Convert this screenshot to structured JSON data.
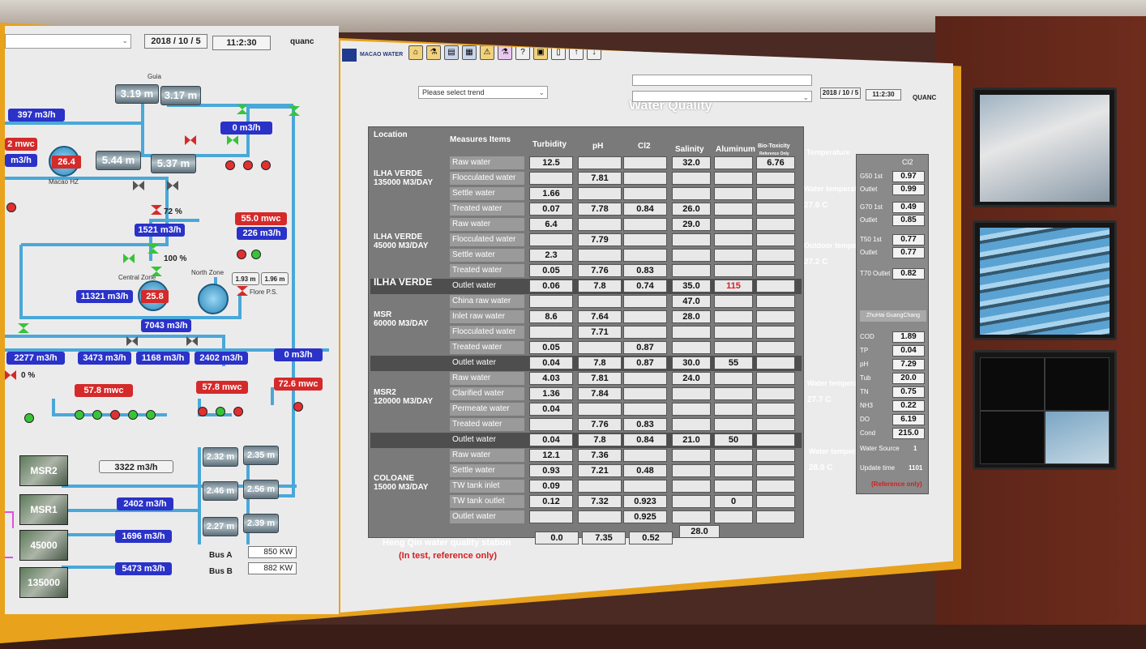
{
  "left_panel": {
    "date": "2018 / 10 / 5",
    "time": "11:2:30",
    "user": "quanc",
    "labels": {
      "guia": "Guia",
      "macao_hz": "Macao HZ",
      "central_zone": "Central Zone",
      "north_zone": "North Zone",
      "flore_ps": "Flore P.S."
    },
    "tanks": [
      "3.19 m",
      "3.17 m",
      "5.44 m",
      "5.37 m",
      "2.32 m",
      "2.35 m",
      "2.46 m",
      "2.56 m",
      "2.27 m",
      "2.39 m"
    ],
    "small_tanks": [
      "1.93 m",
      "1.96 m"
    ],
    "flows_blue": [
      "397 m3/h",
      "0 m3/h",
      "1521 m3/h",
      "226 m3/h",
      "11321 m3/h",
      "7043 m3/h",
      "2277 m3/h",
      "3473 m3/h",
      "1168 m3/h",
      "2402 m3/h",
      "0 m3/h",
      "2402 m3/h",
      "1696 m3/h",
      "5473 m3/h"
    ],
    "flows_red": [
      "2 mwc",
      "55.0 mwc",
      "57.8 mwc",
      "57.8 mwc",
      "72.6 mwc"
    ],
    "flows_left_cut": "m3/h",
    "dial_values": [
      "26.4",
      "25.8"
    ],
    "percents": [
      "72 %",
      "100 %",
      "0 %"
    ],
    "plant_thumbs": [
      "MSR2",
      "MSR1",
      "45000",
      "135000"
    ],
    "msr2_flow": "3322 m3/h",
    "bus": [
      {
        "label": "Bus A",
        "value": "850 KW"
      },
      {
        "label": "Bus B",
        "value": "882 KW"
      }
    ]
  },
  "main_panel": {
    "brand": "MACAO WATER",
    "trend_select": "Please select trend",
    "title": "Water Quality",
    "date": "2018 / 10 / 5",
    "time": "11:2:30",
    "user": "QUANC",
    "headers": [
      "Location",
      "Measures Items",
      "Turbidity",
      "pH",
      "Cl2",
      "Salinity",
      "Aluminum",
      "Bio-Toxicity",
      "Reference Only",
      "Temperature"
    ],
    "rows": [
      {
        "item": "Raw water",
        "vals": [
          "12.5",
          "",
          "",
          "32.0",
          "",
          "6.76"
        ]
      },
      {
        "item": "Flocculated water",
        "vals": [
          "",
          "7.81",
          "",
          "",
          "",
          ""
        ]
      },
      {
        "item": "Settle water",
        "vals": [
          "1.66",
          "",
          "",
          "",
          "",
          ""
        ]
      },
      {
        "item": "Treated water",
        "vals": [
          "0.07",
          "7.78",
          "0.84",
          "26.0",
          "",
          ""
        ]
      },
      {
        "item": "Raw water",
        "vals": [
          "6.4",
          "",
          "",
          "29.0",
          "",
          ""
        ]
      },
      {
        "item": "Flocculated water",
        "vals": [
          "",
          "7.79",
          "",
          "",
          "",
          ""
        ]
      },
      {
        "item": "Settle water",
        "vals": [
          "2.3",
          "",
          "",
          "",
          "",
          ""
        ]
      },
      {
        "item": "Treated water",
        "vals": [
          "0.05",
          "7.76",
          "0.83",
          "",
          "",
          ""
        ]
      },
      {
        "item": "Outlet water",
        "vals": [
          "0.06",
          "7.8",
          "0.74",
          "35.0",
          "115",
          ""
        ]
      },
      {
        "item": "China raw water",
        "vals": [
          "",
          "",
          "",
          "47.0",
          "",
          ""
        ]
      },
      {
        "item": "Inlet raw water",
        "vals": [
          "8.6",
          "7.64",
          "",
          "28.0",
          "",
          ""
        ]
      },
      {
        "item": "Flocculated water",
        "vals": [
          "",
          "7.71",
          "",
          "",
          "",
          ""
        ]
      },
      {
        "item": "Treated water",
        "vals": [
          "0.05",
          "",
          "0.87",
          "",
          "",
          ""
        ]
      },
      {
        "item": "Outlet water",
        "vals": [
          "0.04",
          "7.8",
          "0.87",
          "30.0",
          "55",
          ""
        ]
      },
      {
        "item": "Raw water",
        "vals": [
          "4.03",
          "7.81",
          "",
          "24.0",
          "",
          ""
        ]
      },
      {
        "item": "Clarified water",
        "vals": [
          "1.36",
          "7.84",
          "",
          "",
          "",
          ""
        ]
      },
      {
        "item": "Permeate water",
        "vals": [
          "0.04",
          "",
          "",
          "",
          "",
          ""
        ]
      },
      {
        "item": "Treated water",
        "vals": [
          "",
          "7.76",
          "0.83",
          "",
          "",
          ""
        ]
      },
      {
        "item": "Outlet water",
        "vals": [
          "0.04",
          "7.8",
          "0.84",
          "21.0",
          "50",
          ""
        ]
      },
      {
        "item": "Raw water",
        "vals": [
          "12.1",
          "7.36",
          "",
          "",
          "",
          ""
        ]
      },
      {
        "item": "Settle water",
        "vals": [
          "0.93",
          "7.21",
          "0.48",
          "",
          "",
          ""
        ]
      },
      {
        "item": "TW tank inlet",
        "vals": [
          "0.09",
          "",
          "",
          "",
          "",
          ""
        ]
      },
      {
        "item": "TW tank outlet",
        "vals": [
          "0.12",
          "7.32",
          "0.923",
          "",
          "0",
          ""
        ]
      },
      {
        "item": "Outlet water",
        "vals": [
          "",
          "",
          "0.925",
          "",
          "",
          ""
        ]
      }
    ],
    "locations": [
      "ILHA VERDE",
      "135000 M3/DAY",
      "ILHA VERDE",
      "45000 M3/DAY",
      "ILHA VERDE",
      "MSR",
      "60000 M3/DAY",
      "MSR2",
      "120000 M3/DAY",
      "COLOANE",
      "15000 M3/DAY"
    ],
    "temps": [
      {
        "label": "Water temperature",
        "value": "27.0 C"
      },
      {
        "label": "Outdoor temperature",
        "value": "27.2 C"
      },
      {
        "label": "Water temperature",
        "value": "27.7 C"
      },
      {
        "label": "Water temperature",
        "value": "28.0 C"
      }
    ],
    "right_box": {
      "cl2_header": "Cl2",
      "pairs": [
        {
          "label": "G50 1st",
          "value": "0.97"
        },
        {
          "label": "Outlet",
          "value": "0.99"
        },
        {
          "label": "G70 1st",
          "value": "0.49"
        },
        {
          "label": "Outlet",
          "value": "0.85"
        },
        {
          "label": "T50 1st",
          "value": "0.77"
        },
        {
          "label": "Outlet",
          "value": "0.77"
        },
        {
          "label": "T70 Outlet",
          "value": "0.82"
        }
      ],
      "section": "ZhuHai GuangChang",
      "metrics": [
        {
          "label": "COD",
          "value": "1.89"
        },
        {
          "label": "TP",
          "value": "0.04"
        },
        {
          "label": "pH",
          "value": "7.29"
        },
        {
          "label": "Tub",
          "value": "20.0"
        },
        {
          "label": "TN",
          "value": "0.75"
        },
        {
          "label": "NH3",
          "value": "0.22"
        },
        {
          "label": "DO",
          "value": "6.19"
        },
        {
          "label": "Cond",
          "value": "215.0"
        }
      ],
      "water_source_label": "Water Source",
      "water_source_value": "1",
      "update_label": "Update time",
      "update_value": "1101",
      "note": "(Reference only)"
    },
    "hengqin": {
      "label": "Heng Qin water quality station",
      "note": "(In test, reference only)",
      "vals": [
        "0.0",
        "7.35",
        "0.52",
        "28.0"
      ]
    }
  }
}
